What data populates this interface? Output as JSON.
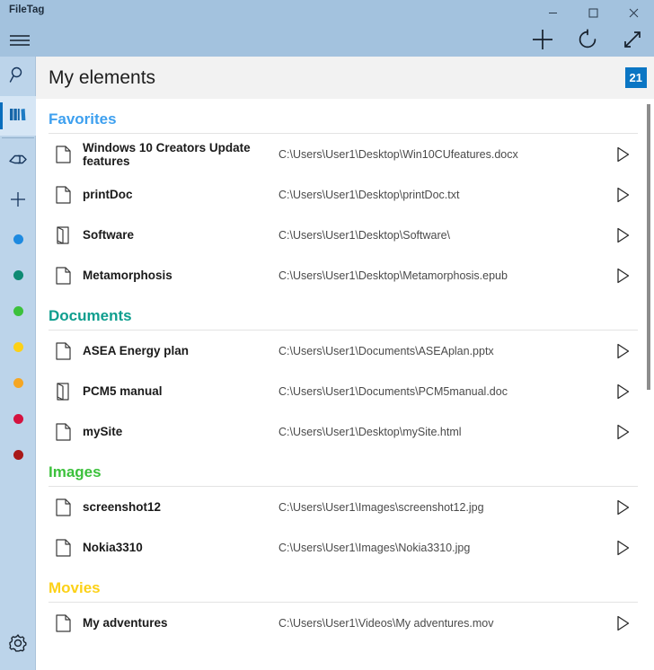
{
  "window": {
    "app_title": "FileTag",
    "minimize_label": "Minimize",
    "maximize_label": "Maximize",
    "close_label": "Close"
  },
  "toolbar": {
    "menu_label": "Menu",
    "add_label": "Add",
    "refresh_label": "Refresh",
    "expand_label": "Expand"
  },
  "sidebar": {
    "items": [
      {
        "name": "search-icon",
        "label": "Search",
        "active": false
      },
      {
        "name": "library-icon",
        "label": "Library",
        "active": true
      },
      {
        "name": "tag-icon",
        "label": "Tags",
        "active": false
      },
      {
        "name": "plus-icon",
        "label": "Add tag",
        "active": false
      }
    ],
    "tag_colors": [
      {
        "label": "Blue tag",
        "color": "#1e8ae0"
      },
      {
        "label": "Teal tag",
        "color": "#0e8a73"
      },
      {
        "label": "Green tag",
        "color": "#3cc13c"
      },
      {
        "label": "Yellow tag",
        "color": "#fcd117"
      },
      {
        "label": "Orange tag",
        "color": "#f5a623"
      },
      {
        "label": "Crimson tag",
        "color": "#d4123f"
      },
      {
        "label": "Dark red tag",
        "color": "#a81818"
      }
    ],
    "settings_label": "Settings"
  },
  "page": {
    "title": "My elements",
    "count": "21"
  },
  "sections": [
    {
      "title": "Favorites",
      "color": "#3ea0ef",
      "rows": [
        {
          "icon": "document-icon",
          "name": "Windows 10 Creators Update features",
          "path": "C:\\Users\\User1\\Desktop\\Win10CUfeatures.docx",
          "tall": true
        },
        {
          "icon": "document-icon",
          "name": "printDoc",
          "path": "C:\\Users\\User1\\Desktop\\printDoc.txt",
          "tall": false
        },
        {
          "icon": "folder-icon",
          "name": "Software",
          "path": "C:\\Users\\User1\\Desktop\\Software\\",
          "tall": false
        },
        {
          "icon": "document-icon",
          "name": "Metamorphosis",
          "path": "C:\\Users\\User1\\Desktop\\Metamorphosis.epub",
          "tall": false
        }
      ]
    },
    {
      "title": "Documents",
      "color": "#0e9e8e",
      "rows": [
        {
          "icon": "document-icon",
          "name": "ASEA Energy plan",
          "path": "C:\\Users\\User1\\Documents\\ASEAplan.pptx",
          "tall": false
        },
        {
          "icon": "folder-icon",
          "name": "PCM5 manual",
          "path": "C:\\Users\\User1\\Documents\\PCM5manual.doc",
          "tall": false
        },
        {
          "icon": "document-icon",
          "name": "mySite",
          "path": "C:\\Users\\User1\\Desktop\\mySite.html",
          "tall": false
        }
      ]
    },
    {
      "title": "Images",
      "color": "#3cc13c",
      "rows": [
        {
          "icon": "document-icon",
          "name": "screenshot12",
          "path": "C:\\Users\\User1\\Images\\screenshot12.jpg",
          "tall": false
        },
        {
          "icon": "document-icon",
          "name": "Nokia3310",
          "path": "C:\\Users\\User1\\Images\\Nokia3310.jpg",
          "tall": false
        }
      ]
    },
    {
      "title": "Movies",
      "color": "#fcd117",
      "rows": [
        {
          "icon": "document-icon",
          "name": "My adventures",
          "path": "C:\\Users\\User1\\Videos\\My adventures.mov",
          "tall": false
        }
      ]
    }
  ],
  "colors": {
    "titlebar": "#a3c2de",
    "sidebar": "#bcd4ea",
    "sidebar_active": "#d6e6f5",
    "accent": "#0b76c4",
    "header_strip": "#f2f2f2"
  },
  "icons": {
    "play_label": "Open",
    "document_label": "Document",
    "folder_label": "Folder"
  }
}
